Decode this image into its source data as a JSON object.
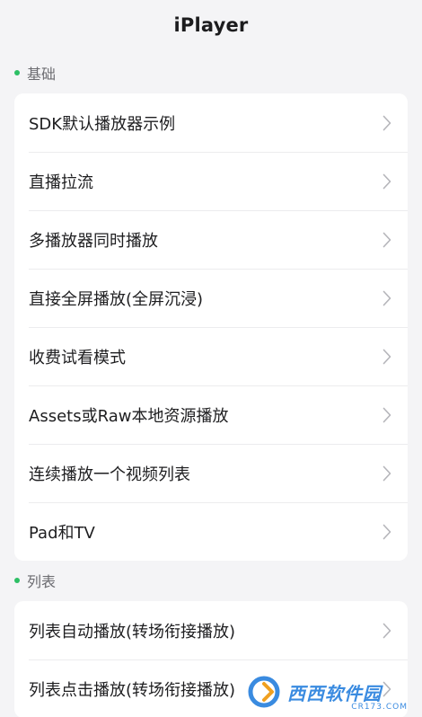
{
  "header": {
    "title": "iPlayer"
  },
  "sections": {
    "basic": {
      "label": "基础",
      "items": [
        {
          "label": "SDK默认播放器示例"
        },
        {
          "label": "直播拉流"
        },
        {
          "label": "多播放器同时播放"
        },
        {
          "label": "直接全屏播放(全屏沉浸)"
        },
        {
          "label": "收费试看模式"
        },
        {
          "label": "Assets或Raw本地资源播放"
        },
        {
          "label": "连续播放一个视频列表"
        },
        {
          "label": "Pad和TV"
        }
      ]
    },
    "list": {
      "label": "列表",
      "items": [
        {
          "label": "列表自动播放(转场衔接播放)"
        },
        {
          "label": "列表点击播放(转场衔接播放)"
        }
      ]
    }
  },
  "watermark": {
    "text": "西西软件园",
    "sub": "CR173.COM"
  },
  "colors": {
    "accent": "#2dbf65",
    "chevron": "#b5b5ba",
    "watermark": "#3a8be0"
  }
}
